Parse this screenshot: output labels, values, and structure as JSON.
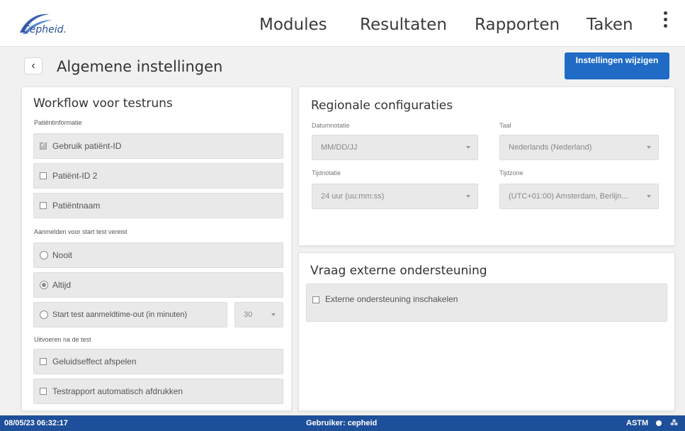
{
  "brand": {
    "logo_text": "Cepheid.",
    "accent": "#1f6bc6",
    "statusbar_color": "#1e4f9a"
  },
  "nav": {
    "items": [
      "Modules",
      "Resultaten",
      "Rapporten",
      "Taken"
    ],
    "menu_icon": "kebab-menu-icon"
  },
  "header": {
    "back_icon": "chevron-left-icon",
    "back_label": "‹",
    "title": "Algemene instellingen",
    "edit_button": "Instellingen wijzigen"
  },
  "workflow": {
    "title": "Workflow voor testruns",
    "patient_label": "Patiëntinformatie",
    "patient_items": [
      {
        "label": "Gebruik patiënt-ID",
        "checked": true
      },
      {
        "label": "Patiënt-ID 2",
        "checked": false
      },
      {
        "label": "Patiëntnaam",
        "checked": false
      }
    ],
    "login_label": "Aanmelden voor start test vereist",
    "login_options": [
      {
        "label": "Nooit",
        "selected": false
      },
      {
        "label": "Altijd",
        "selected": true
      },
      {
        "label": "Start test aanmeldtime-out (in minuten)",
        "selected": false
      }
    ],
    "timeout_value": "30",
    "after_label": "Uitvoeren na de test",
    "after_items": [
      {
        "label": "Geluidseffect afspelen",
        "checked": false
      },
      {
        "label": "Testrapport automatisch afdrukken",
        "checked": false
      }
    ]
  },
  "regional": {
    "title": "Regionale configuraties",
    "date_label": "Datumnotatie",
    "date_value": "MM/DD/JJ",
    "lang_label": "Taal",
    "lang_value": "Nederlands (Nederland)",
    "time_label": "Tijdnotatie",
    "time_value": "24 uur (uu:mm:ss)",
    "tz_label": "Tijdzone",
    "tz_value": "(UTC+01:00) Amsterdam, Berlijn..."
  },
  "support": {
    "title": "Vraag externe ondersteuning",
    "item": "Externe ondersteuning inschakelen"
  },
  "status": {
    "datetime": "08/05/23 06:32:17",
    "user": "Gebruiker: cepheid",
    "astm": "ASTM",
    "network_icon": "network-icon"
  }
}
